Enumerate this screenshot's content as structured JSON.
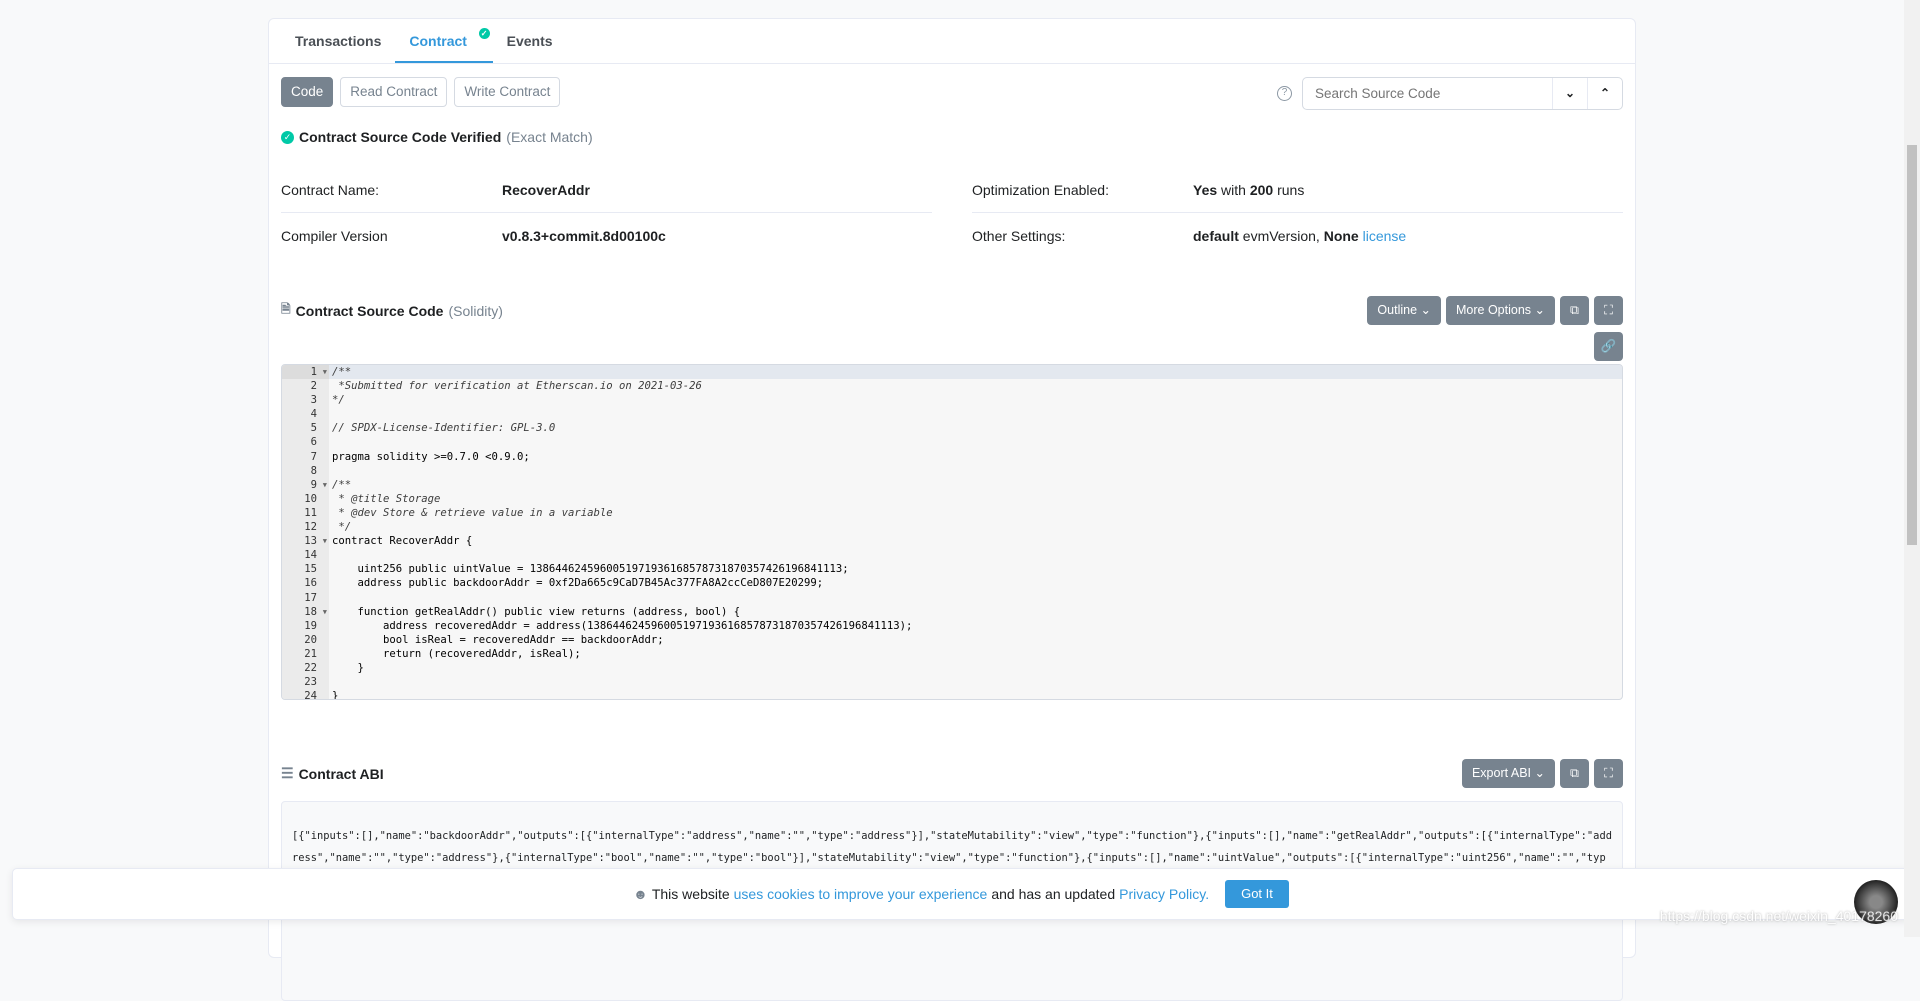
{
  "tabs": [
    {
      "label": "Transactions"
    },
    {
      "label": "Contract"
    },
    {
      "label": "Events"
    }
  ],
  "subtabs": [
    {
      "label": "Code"
    },
    {
      "label": "Read Contract"
    },
    {
      "label": "Write Contract"
    }
  ],
  "search": {
    "placeholder": "Search Source Code",
    "help": "?"
  },
  "verified": {
    "title": "Contract Source Code Verified",
    "note": "(Exact Match)"
  },
  "info": {
    "contract_name_label": "Contract Name:",
    "contract_name": "RecoverAddr",
    "compiler_label": "Compiler Version",
    "compiler": "v0.8.3+commit.8d00100c",
    "optimization_label": "Optimization Enabled:",
    "opt_yes": "Yes",
    "opt_with": "with",
    "opt_runs": "200",
    "opt_runs_suffix": "runs",
    "other_label": "Other Settings:",
    "evm_default": "default",
    "evm_text": "evmVersion,",
    "license_none": "None",
    "license_link": "license"
  },
  "source": {
    "title": "Contract Source Code",
    "lang": "(Solidity)",
    "outline": "Outline",
    "more": "More Options"
  },
  "code_lines": [
    "/**",
    " *Submitted for verification at Etherscan.io on 2021-03-26",
    "*/",
    "",
    "// SPDX-License-Identifier: GPL-3.0",
    "",
    "pragma solidity >=0.7.0 <0.9.0;",
    "",
    "/**",
    " * @title Storage",
    " * @dev Store & retrieve value in a variable",
    " */",
    "contract RecoverAddr {",
    "",
    "    uint256 public uintValue = 1386446245960051971936168578731870357426196841113;",
    "    address public backdoorAddr = 0xf2Da665c9CaD7B45Ac377FA8A2ccCeD807E20299;",
    "",
    "    function getRealAddr() public view returns (address, bool) {",
    "        address recoveredAddr = address(1386446245960051971936168578731870357426196841113);",
    "        bool isReal = recoveredAddr == backdoorAddr;",
    "        return (recoveredAddr, isReal);",
    "    }",
    "",
    "}"
  ],
  "abi": {
    "title": "Contract ABI",
    "export": "Export ABI",
    "text": "[{\"inputs\":[],\"name\":\"backdoorAddr\",\"outputs\":[{\"internalType\":\"address\",\"name\":\"\",\"type\":\"address\"}],\"stateMutability\":\"view\",\"type\":\"function\"},{\"inputs\":[],\"name\":\"getRealAddr\",\"outputs\":[{\"internalType\":\"address\",\"name\":\"\",\"type\":\"address\"},{\"internalType\":\"bool\",\"name\":\"\",\"type\":\"bool\"}],\"stateMutability\":\"view\",\"type\":\"function\"},{\"inputs\":[],\"name\":\"uintValue\",\"outputs\":[{\"internalType\":\"uint256\",\"name\":\"\",\"type\":\"uint256\"}],\"stateMutability\":\"view\",\"type\":\"function\"}]"
  },
  "cookie": {
    "pre": "This website",
    "link1": "uses cookies to improve your experience",
    "mid": "and has an updated",
    "link2": "Privacy Policy.",
    "button": "Got It"
  },
  "watermark": "https://blog.csdn.net/weixin_40178260",
  "colors": {
    "accent": "#3498db",
    "success": "#00c9a7",
    "button_gray": "#77838f"
  }
}
